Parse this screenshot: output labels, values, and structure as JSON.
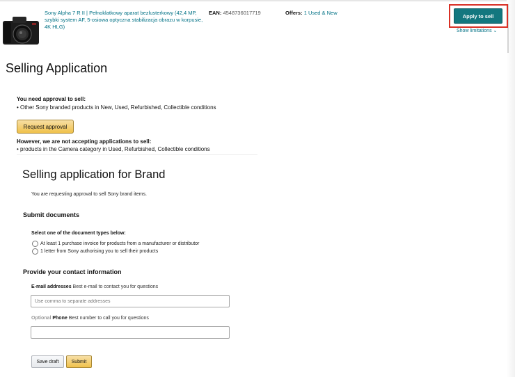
{
  "product": {
    "title": "Sony Alpha 7 R II | Pełnoklatkowy aparat bezlusterkowy (42,4 MP, szybki system AF, 5-osiowa optyczna stabilizacja obrazu w korpusie, 4K HLG)",
    "ean_label": "EAN:",
    "ean_value": "4548736017719",
    "offers_label": "Offers:",
    "offers_link": "1 Used & New",
    "apply_button": "Apply to sell",
    "show_limitations": "Show limitations"
  },
  "page_title": "Selling Application",
  "approval": {
    "need_heading": "You need approval to sell:",
    "need_item": "Other Sony branded products in New, Used, Refurbished, Collectible conditions",
    "request_button": "Request approval",
    "not_accepting_heading": "However, we are not accepting applications to sell:",
    "not_accepting_item": "products in the Camera category in Used, Refurbished, Collectible conditions"
  },
  "brand_application": {
    "title": "Selling application for Brand",
    "subtitle": "You are requesting approval to sell Sony brand items."
  },
  "documents": {
    "heading": "Submit documents",
    "select_label": "Select one of the document types below:",
    "options": [
      "At least 1 purchase invoice for products from a manufacturer or distributor",
      "1 letter from Sony authorising you to sell their products"
    ]
  },
  "contact": {
    "heading": "Provide your contact information",
    "email_label_bold": "E-mail addresses",
    "email_label_rest": "Best e-mail to contact you for questions",
    "email_placeholder": "Use comma to separate addresses",
    "email_value": "",
    "phone_optional": "Optional",
    "phone_label_bold": "Phone",
    "phone_label_rest": "Best number to call you for questions",
    "phone_value": ""
  },
  "actions": {
    "save_draft": "Save draft",
    "submit": "Submit"
  },
  "colors": {
    "link": "#007185",
    "apply_button": "#13777f",
    "highlight_frame": "#d93025",
    "yellow_button": "#f0c14b"
  }
}
